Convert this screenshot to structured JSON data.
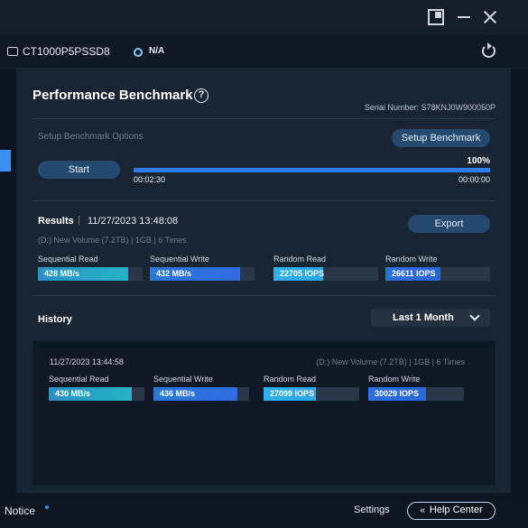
{
  "device": {
    "drive_name": "CT1000P5PSSD8",
    "temperature": "N/A"
  },
  "benchmark": {
    "title": "Performance Benchmark",
    "help_symbol": "?",
    "serial": "Serial Number: S78KNJ0W900050P",
    "setup_label": "Setup Benchmark Options",
    "setup_button": "Setup Benchmark",
    "start_button": "Start",
    "progress_text": "100%",
    "progress_value": 1.0,
    "time_elapsed": "00:02:30",
    "time_remaining": "00:00:00"
  },
  "results": {
    "label": "Results",
    "separator": "|",
    "date": "11/27/2023 13:48:08",
    "info": "(D:) New Volume (7.2TB)  |  1GB  |  6 Times",
    "export_button": "Export",
    "metrics": [
      {
        "label": "Sequential Read",
        "value": "428 MB/s",
        "fill": 0.86
      },
      {
        "label": "Sequential Write",
        "value": "432 MB/s",
        "fill": 0.86
      },
      {
        "label": "Random Read",
        "value": "22705 IOPS",
        "fill": 0.47
      },
      {
        "label": "Random Write",
        "value": "26611 IOPS",
        "fill": 0.53
      }
    ]
  },
  "history": {
    "label": "History",
    "range": "Last 1 Month",
    "entry": {
      "date": "11/27/2023 13:44:58",
      "info": "(D:) New Volume (7.2TB)  |  1GB  |  6 Times",
      "metrics": [
        {
          "label": "Sequential Read",
          "value": "430 MB/s",
          "fill": 0.87
        },
        {
          "label": "Sequential Write",
          "value": "436 MB/s",
          "fill": 0.88
        },
        {
          "label": "Random Read",
          "value": "27099 IOPS",
          "fill": 0.55
        },
        {
          "label": "Random Write",
          "value": "30029 IOPS",
          "fill": 0.6
        }
      ]
    }
  },
  "footer": {
    "notice": "Notice",
    "settings": "Settings",
    "help_center_arrow": "«",
    "help_center": "Help Center"
  }
}
